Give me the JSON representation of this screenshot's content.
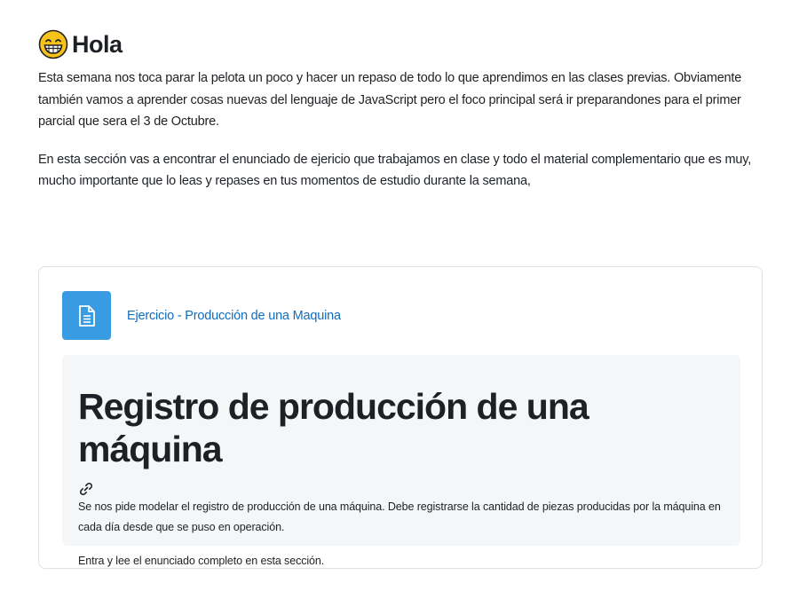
{
  "intro": {
    "heading": "Hola",
    "emoji_icon": "grinning-face-icon",
    "paragraph1": "Esta semana nos toca parar la pelota un poco y hacer un repaso de todo lo que aprendimos en las clases previas. Obviamente también vamos a aprender cosas nuevas del lenguaje de JavaScript pero el foco principal será ir preparandones para el primer parcial que sera el 3 de Octubre.",
    "paragraph2": "En esta sección vas a encontrar el enunciado de ejericio que trabajamos en clase y todo el material complementario que es muy, mucho importante que lo leas y repases en tus momentos de estudio durante la semana,"
  },
  "activity": {
    "icon": "page-icon",
    "link_label": "Ejercicio - Producción de una Maquina",
    "icon_color": "#399be2",
    "link_color": "#0f6cbf"
  },
  "description": {
    "title": "Registro de producción de una máquina",
    "anchor_icon": "link-icon",
    "text1": "Se nos pide modelar el registro de producción de una máquina. Debe registrarse la cantidad de piezas producidas por la máquina en cada día desde que se puso en operación.",
    "text2": "Entra y lee el enunciado completo en esta sección."
  }
}
